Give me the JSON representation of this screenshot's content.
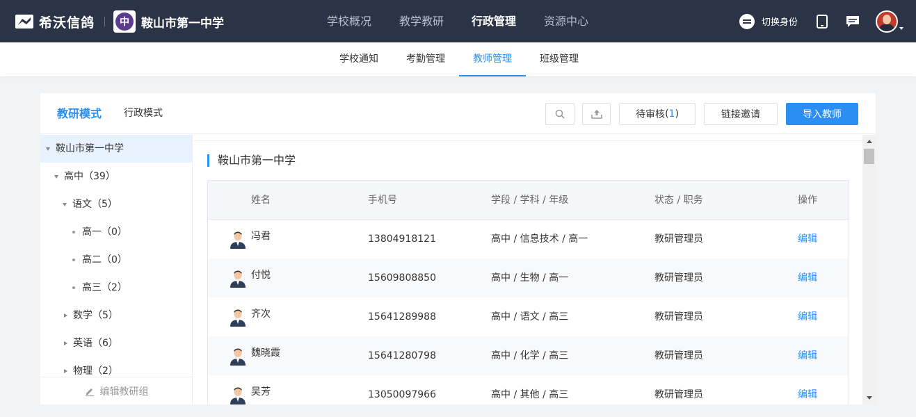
{
  "topbar": {
    "brand_name": "希沃信鸽",
    "school_logo_char": "中",
    "school_name": "鞍山市第一中学",
    "nav": [
      {
        "label": "学校概况",
        "active": false
      },
      {
        "label": "教学教研",
        "active": false
      },
      {
        "label": "行政管理",
        "active": true
      },
      {
        "label": "资源中心",
        "active": false
      }
    ],
    "switch_identity": "切换身份"
  },
  "subnav": {
    "items": [
      {
        "label": "学校通知",
        "active": false
      },
      {
        "label": "考勤管理",
        "active": false
      },
      {
        "label": "教师管理",
        "active": true
      },
      {
        "label": "班级管理",
        "active": false
      }
    ]
  },
  "header": {
    "mode_tabs": [
      {
        "label": "教研模式",
        "active": true
      },
      {
        "label": "行政模式",
        "active": false
      }
    ],
    "pending_label": "待审核",
    "pending_open": "(",
    "pending_count": "1",
    "pending_close": ")",
    "invite_label": "链接邀请",
    "import_label": "导入教师"
  },
  "tree": {
    "nodes": [
      {
        "label": "鞍山市第一中学",
        "type": "expanded",
        "selected": true
      },
      {
        "label": "高中（39）",
        "type": "expanded",
        "selected": false
      },
      {
        "label": "语文（5）",
        "type": "expanded",
        "selected": false
      },
      {
        "label": "高一（0）",
        "type": "leaf",
        "selected": false
      },
      {
        "label": "高二（0）",
        "type": "leaf",
        "selected": false
      },
      {
        "label": "高三（2）",
        "type": "leaf",
        "selected": false
      },
      {
        "label": "数学（5）",
        "type": "collapsed",
        "selected": false
      },
      {
        "label": "英语（6）",
        "type": "collapsed",
        "selected": false
      },
      {
        "label": "物理（2）",
        "type": "collapsed",
        "selected": false
      }
    ],
    "footer_label": "编辑教研组"
  },
  "content": {
    "section_title": "鞍山市第一中学",
    "columns": [
      "姓名",
      "手机号",
      "学段 / 学科 / 年级",
      "状态 / 职务",
      "操作"
    ],
    "rows": [
      {
        "name": "冯君",
        "phone": "13804918121",
        "stage": "高中 / 信息技术 / 高一",
        "status": "教研管理员",
        "action": "编辑"
      },
      {
        "name": "付悦",
        "phone": "15609808850",
        "stage": "高中 / 生物 / 高一",
        "status": "教研管理员",
        "action": "编辑"
      },
      {
        "name": "齐次",
        "phone": "15641289988",
        "stage": "高中 / 语文 / 高三",
        "status": "教研管理员",
        "action": "编辑"
      },
      {
        "name": "魏晓霞",
        "phone": "15641280798",
        "stage": "高中 / 化学 / 高三",
        "status": "教研管理员",
        "action": "编辑"
      },
      {
        "name": "吴芳",
        "phone": "13050097966",
        "stage": "高中 / 其他 / 高三",
        "status": "教研管理员",
        "action": "编辑"
      }
    ]
  },
  "colors": {
    "topbar_bg": "#2b3346",
    "accent": "#2b8ef3",
    "page_bg": "#f2f3f5"
  }
}
